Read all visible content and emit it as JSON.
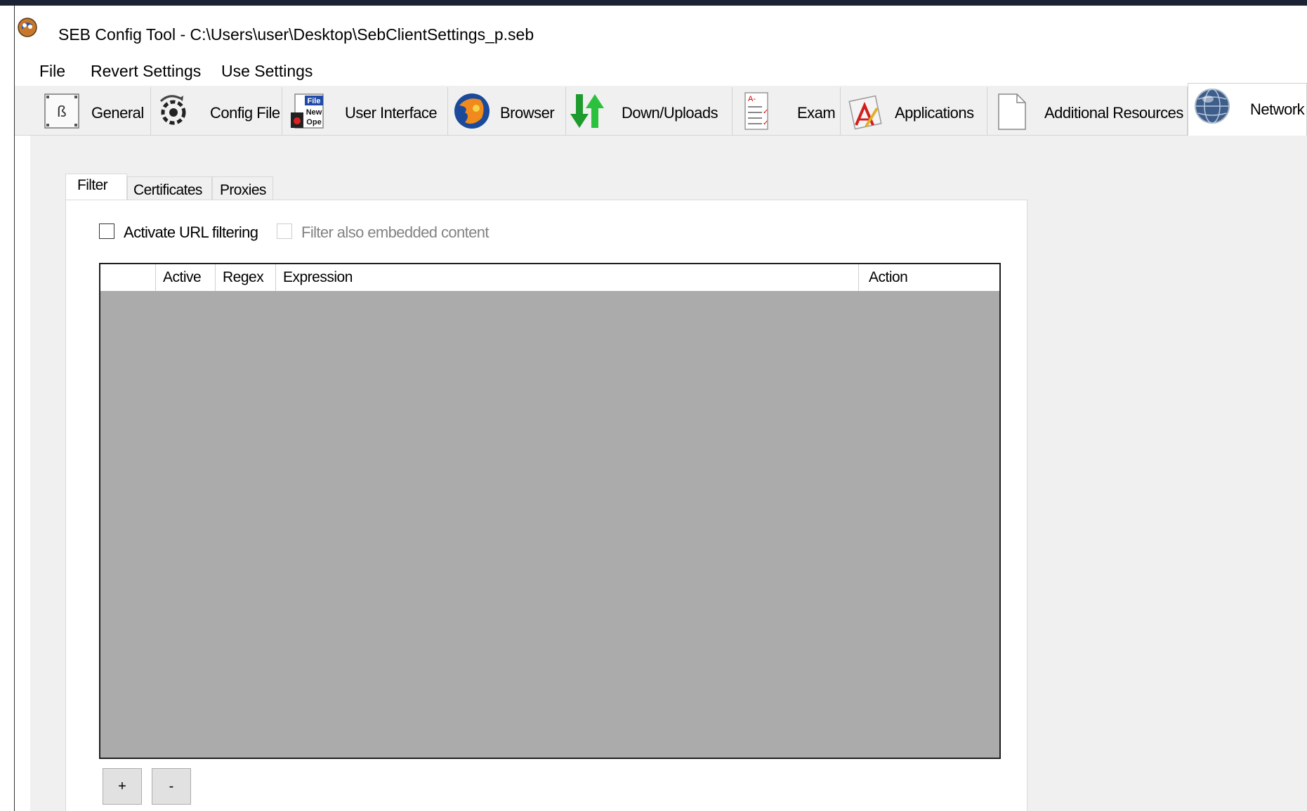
{
  "window": {
    "title": "SEB Config Tool - C:\\Users\\user\\Desktop\\SebClientSettings_p.seb",
    "icon": "seb-logo-icon"
  },
  "menu": [
    "File",
    "Revert Settings",
    "Use Settings"
  ],
  "tabs": [
    {
      "label": "General",
      "icon": "general-icon"
    },
    {
      "label": "Config File",
      "icon": "config-file-icon"
    },
    {
      "label": "User Interface",
      "icon": "user-interface-icon"
    },
    {
      "label": "Browser",
      "icon": "browser-icon"
    },
    {
      "label": "Down/Uploads",
      "icon": "down-uploads-icon"
    },
    {
      "label": "Exam",
      "icon": "exam-icon"
    },
    {
      "label": "Applications",
      "icon": "applications-icon"
    },
    {
      "label": "Additional Resources",
      "icon": "additional-resources-icon"
    },
    {
      "label": "Network",
      "icon": "network-icon",
      "active": true
    }
  ],
  "subtabs": [
    {
      "label": "Filter",
      "active": true
    },
    {
      "label": "Certificates"
    },
    {
      "label": "Proxies"
    }
  ],
  "filter": {
    "activate_label": "Activate URL filtering",
    "activate_checked": false,
    "embedded_label": "Filter also embedded content",
    "embedded_checked": false,
    "embedded_enabled": false
  },
  "grid": {
    "columns": [
      "",
      "Active",
      "Regex",
      "Expression",
      "Action"
    ],
    "rows": []
  },
  "buttons": {
    "add": "+",
    "remove": "-"
  },
  "colors": {
    "grid_empty": "#ababab",
    "toolbar": "#f0f0f0",
    "accent_green": "#22a834"
  }
}
